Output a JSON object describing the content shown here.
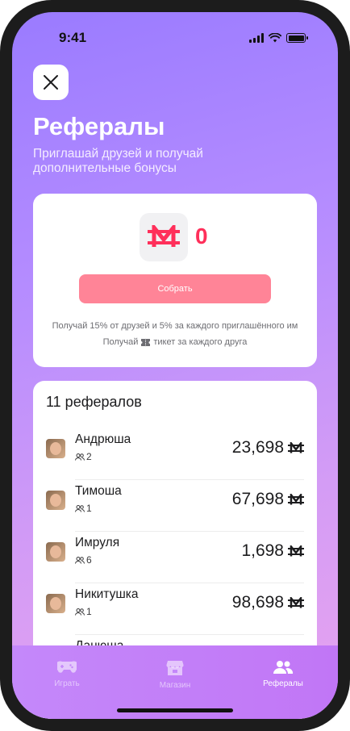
{
  "status_bar": {
    "time": "9:41"
  },
  "header": {
    "title": "Рефералы",
    "subtitle": "Приглашай друзей и получай дополнительные бонусы"
  },
  "reward": {
    "amount": "0",
    "collect_label": "Собрать",
    "hint_line1": "Получай 15% от друзей и 5% за каждого приглашённого им",
    "hint_line2_before": "Получай",
    "hint_line2_after": "тикет за каждого друга",
    "accent_color": "#ff2f5a"
  },
  "referrals": {
    "title": "11 рефералов",
    "items": [
      {
        "name": "Андрюша",
        "friends": "2",
        "amount": "23,698"
      },
      {
        "name": "Тимоша",
        "friends": "1",
        "amount": "67,698"
      },
      {
        "name": "Имруля",
        "friends": "6",
        "amount": "1,698"
      },
      {
        "name": "Никитушка",
        "friends": "1",
        "amount": "98,698"
      },
      {
        "name": "Данюша",
        "friends": "",
        "amount": ""
      }
    ]
  },
  "tabbar": {
    "tabs": [
      {
        "label": "Играть",
        "icon": "gamepad-icon",
        "active": false
      },
      {
        "label": "Магазин",
        "icon": "store-icon",
        "active": false
      },
      {
        "label": "Рефералы",
        "icon": "users-icon",
        "active": true
      }
    ]
  }
}
